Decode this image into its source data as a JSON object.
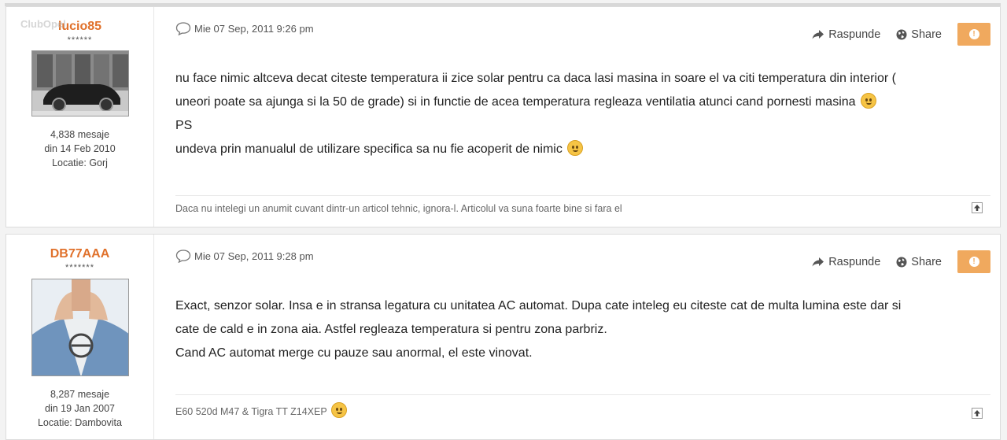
{
  "posts": [
    {
      "author": {
        "name": "lucio85",
        "stars": "******",
        "messages": "4,838 mesaje",
        "joined": "din 14 Feb 2010",
        "location": "Locatie: Gorj",
        "watermark": "ClubOpel"
      },
      "date": "Mie 07 Sep, 2011 9:26 pm",
      "actions": {
        "reply": "Raspunde",
        "share": "Share"
      },
      "lines": [
        "nu face nimic altceva decat citeste temperatura ii zice solar pentru ca daca lasi masina in soare el va citi temperatura din interior (",
        "uneori poate sa ajunga si la 50 de grade) si in functie de acea temperatura regleaza ventilatia atunci cand pornesti masina",
        "PS",
        "undeva prin manualul de utilizare specifica sa nu fie acoperit de nimic"
      ],
      "signature": "Daca nu intelegi un anumit cuvant dintr-un articol tehnic, ignora-l. Articolul va suna foarte bine si fara el"
    },
    {
      "author": {
        "name": "DB77AAA",
        "stars": "*******",
        "messages": "8,287 mesaje",
        "joined": "din 19 Jan 2007",
        "location": "Locatie: Dambovita"
      },
      "date": "Mie 07 Sep, 2011 9:28 pm",
      "actions": {
        "reply": "Raspunde",
        "share": "Share"
      },
      "lines": [
        "Exact, senzor solar. Insa e in stransa legatura cu unitatea AC automat. Dupa cate inteleg eu citeste cat de multa lumina este dar si",
        "cate de cald e in zona aia. Astfel regleaza temperatura si pentru zona parbriz.",
        "Cand AC automat merge cu pauze sau anormal, el este vinovat."
      ],
      "signature": "E60 520d M47 & Tigra TT Z14XEP"
    }
  ]
}
